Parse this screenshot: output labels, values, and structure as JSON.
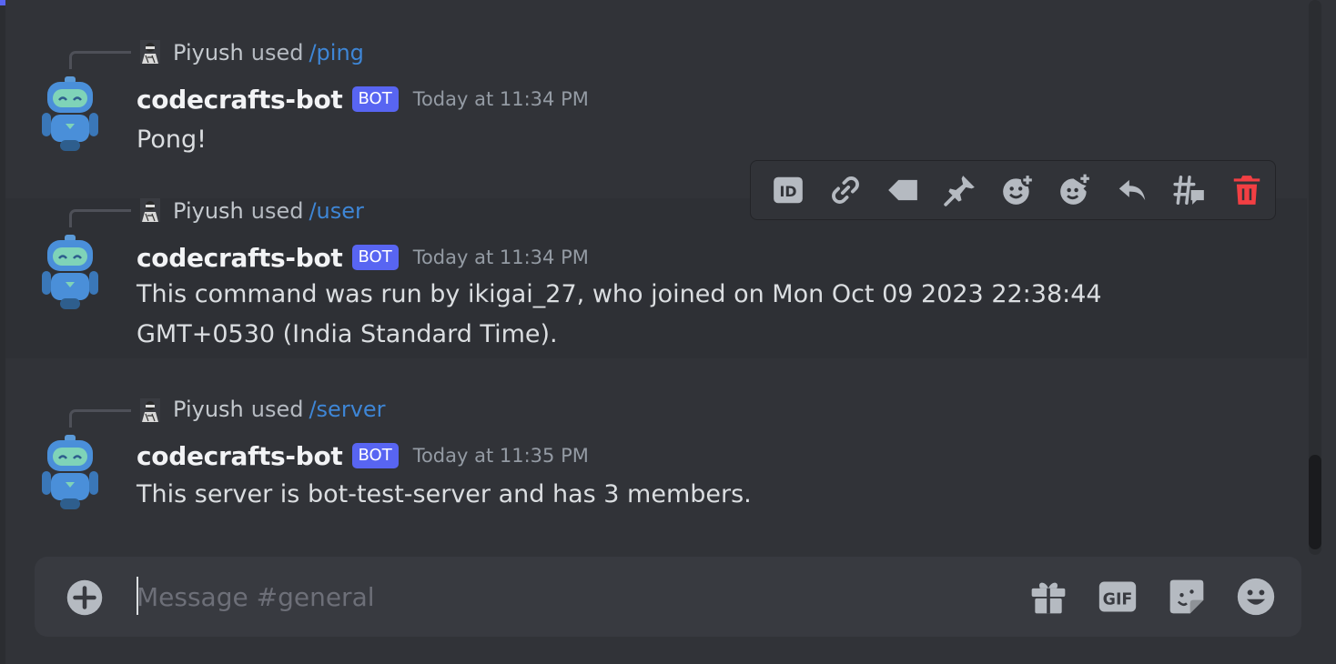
{
  "channel": {
    "composer_placeholder": "Message #general"
  },
  "messages": [
    {
      "reply_user": "Piyush",
      "reply_verb": "used",
      "command": "/ping",
      "author": "codecrafts-bot",
      "tag": "BOT",
      "timestamp": "Today at 11:34 PM",
      "content": "Pong!"
    },
    {
      "reply_user": "Piyush",
      "reply_verb": "used",
      "command": "/user",
      "author": "codecrafts-bot",
      "tag": "BOT",
      "timestamp": "Today at 11:34 PM",
      "content": "This command was run by ikigai_27, who joined on Mon Oct 09 2023 22:38:44 GMT+0530 (India Standard Time)."
    },
    {
      "reply_user": "Piyush",
      "reply_verb": "used",
      "command": "/server",
      "author": "codecrafts-bot",
      "tag": "BOT",
      "timestamp": "Today at 11:35 PM",
      "content": "This server is bot-test-server and has 3 members."
    }
  ],
  "message_actions": [
    "copy-id-icon",
    "copy-link-icon",
    "mark-unread-icon",
    "pin-icon",
    "add-reaction-icon",
    "super-reaction-icon",
    "reply-icon",
    "create-thread-icon",
    "delete-icon"
  ],
  "composer_tools": [
    "upload-plus-icon",
    "gift-icon",
    "gif-icon",
    "sticker-icon",
    "emoji-icon"
  ],
  "colors": {
    "background": "#313338",
    "bot_tag": "#5865f2",
    "command_link": "#3e86d6",
    "delete": "#f23f43"
  }
}
